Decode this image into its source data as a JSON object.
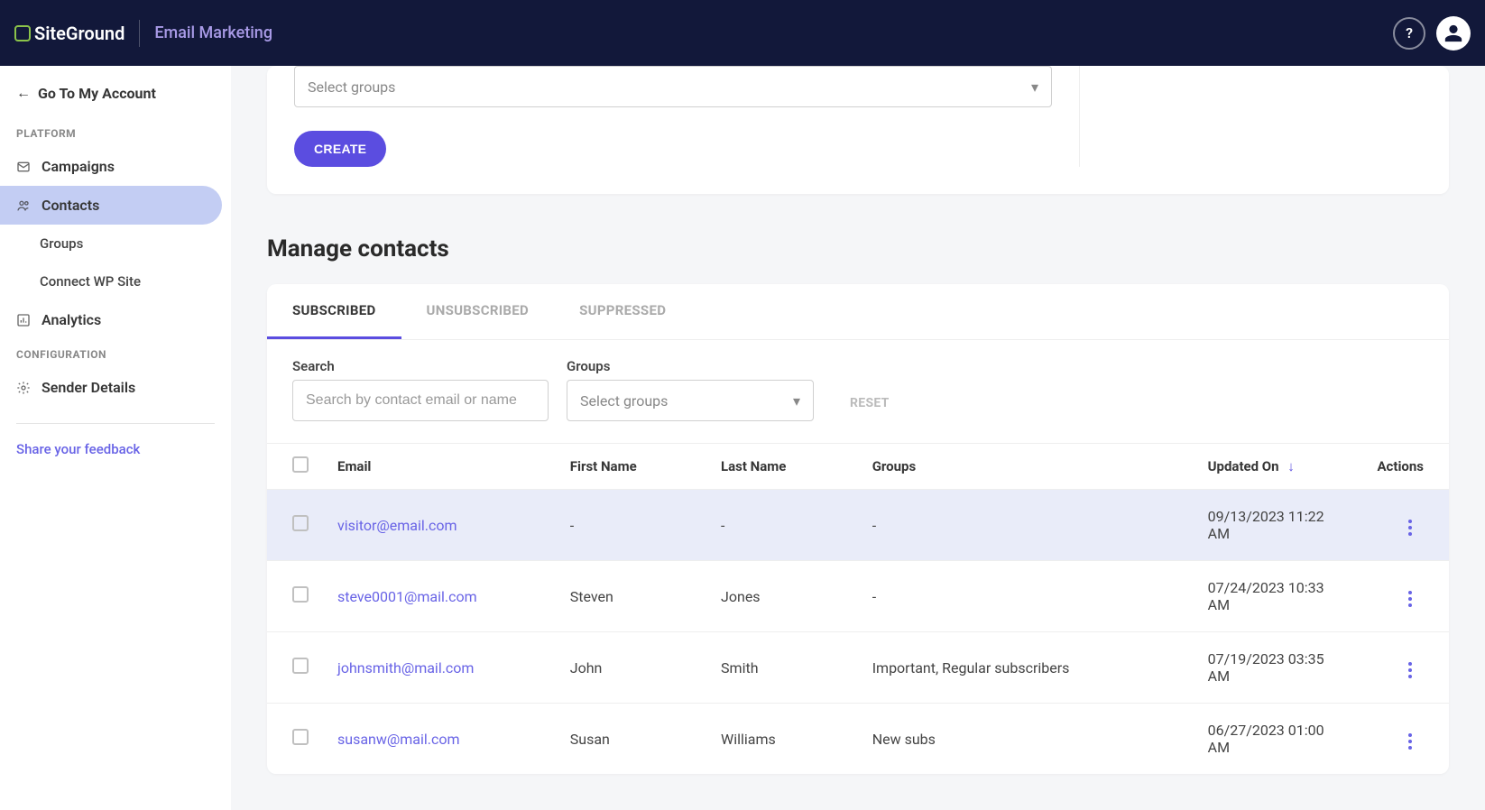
{
  "header": {
    "logo_text": "SiteGround",
    "product": "Email Marketing",
    "help": "?"
  },
  "sidebar": {
    "back_label": "Go To My Account",
    "section_platform": "PLATFORM",
    "items": [
      {
        "label": "Campaigns"
      },
      {
        "label": "Contacts"
      },
      {
        "label": "Analytics"
      }
    ],
    "subitems": [
      {
        "label": "Groups"
      },
      {
        "label": "Connect WP Site"
      }
    ],
    "section_config": "CONFIGURATION",
    "config_items": [
      {
        "label": "Sender Details"
      }
    ],
    "feedback": "Share your feedback"
  },
  "top_card": {
    "groups_placeholder": "Select groups",
    "create_label": "CREATE"
  },
  "page": {
    "title": "Manage contacts"
  },
  "tabs": [
    {
      "label": "SUBSCRIBED",
      "active": true
    },
    {
      "label": "UNSUBSCRIBED",
      "active": false
    },
    {
      "label": "SUPPRESSED",
      "active": false
    }
  ],
  "filters": {
    "search_label": "Search",
    "search_placeholder": "Search by contact email or name",
    "groups_label": "Groups",
    "groups_placeholder": "Select groups",
    "reset": "RESET"
  },
  "columns": {
    "email": "Email",
    "first": "First Name",
    "last": "Last Name",
    "groups": "Groups",
    "updated": "Updated On",
    "actions": "Actions"
  },
  "rows": [
    {
      "email": "visitor@email.com",
      "first": "-",
      "last": "-",
      "groups": "-",
      "updated": "09/13/2023 11:22 AM",
      "highlight": true
    },
    {
      "email": "steve0001@mail.com",
      "first": "Steven",
      "last": "Jones",
      "groups": "-",
      "updated": "07/24/2023 10:33 AM",
      "highlight": false
    },
    {
      "email": "johnsmith@mail.com",
      "first": "John",
      "last": "Smith",
      "groups": "Important, Regular subscribers",
      "updated": "07/19/2023 03:35 AM",
      "highlight": false
    },
    {
      "email": "susanw@mail.com",
      "first": "Susan",
      "last": "Williams",
      "groups": "New subs",
      "updated": "06/27/2023 01:00 AM",
      "highlight": false
    }
  ]
}
